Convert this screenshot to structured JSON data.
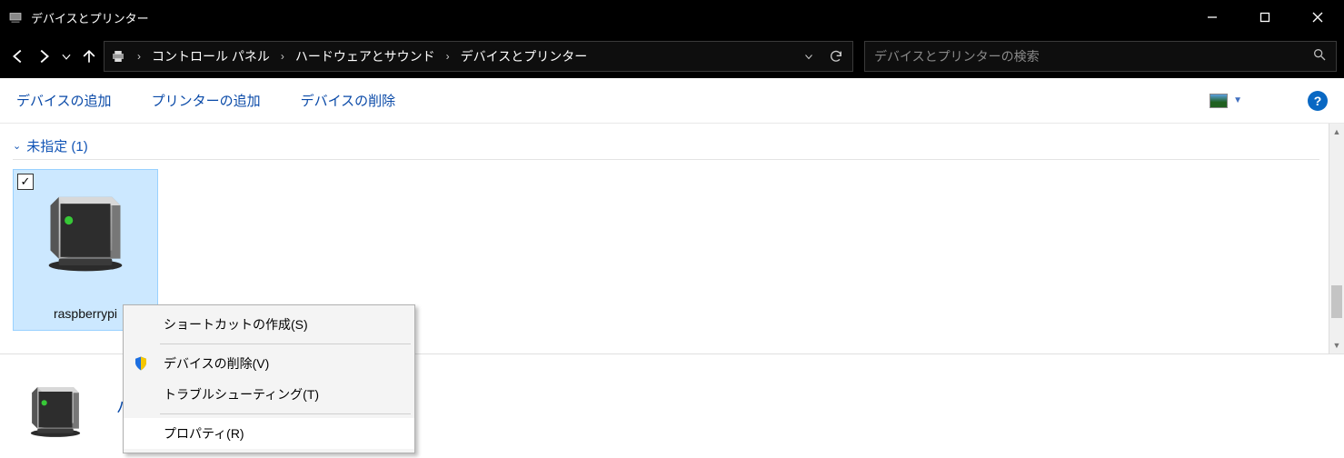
{
  "window": {
    "title": "デバイスとプリンター"
  },
  "breadcrumb": {
    "panel": "コントロール パネル",
    "hardware": "ハードウェアとサウンド",
    "devices": "デバイスとプリンター"
  },
  "search": {
    "placeholder": "デバイスとプリンターの検索"
  },
  "commands": {
    "add_device": "デバイスの追加",
    "add_printer": "プリンターの追加",
    "remove_device": "デバイスの削除"
  },
  "group": {
    "label": "未指定 (1)"
  },
  "device": {
    "name": "raspberrypi"
  },
  "details": {
    "suffix": "バイス"
  },
  "context_menu": {
    "create_shortcut": "ショートカットの作成(S)",
    "remove_device": "デバイスの削除(V)",
    "troubleshoot": "トラブルシューティング(T)",
    "properties": "プロパティ(R)"
  },
  "help_glyph": "?"
}
